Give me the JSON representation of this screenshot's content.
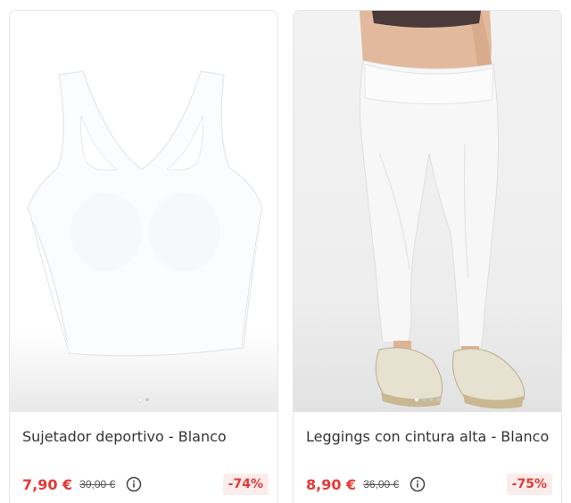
{
  "products": [
    {
      "title": "Sujetador deportivo - Blanco",
      "price": "7,90 €",
      "old_price": "30,00 €",
      "discount": "-74%",
      "image_icon": "sports-bra-image",
      "carousel_dots": 2,
      "active_dot": 1
    },
    {
      "title": "Leggings con cintura alta - Blanco",
      "price": "8,90 €",
      "old_price": "36,00 €",
      "discount": "-75%",
      "image_icon": "leggings-model-image",
      "carousel_dots": 4,
      "active_dot": 1
    }
  ],
  "colors": {
    "price_red": "#e53935",
    "discount_bg": "#fdecec"
  }
}
